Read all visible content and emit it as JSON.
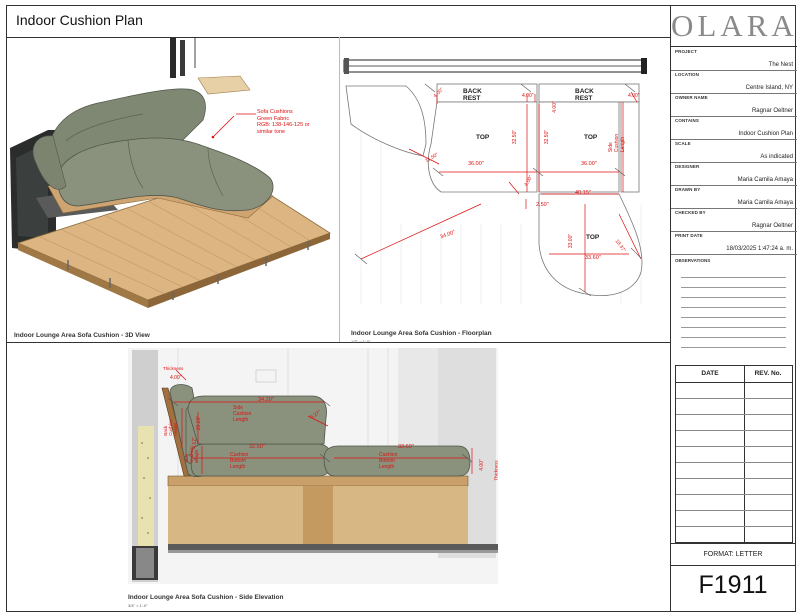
{
  "sheet": {
    "title": "Indoor Cushion Plan",
    "logo": "OLARA",
    "sheet_number": "F1911",
    "format": "FORMAT: LETTER"
  },
  "title_block": {
    "fields": [
      {
        "label": "PROJECT",
        "value": "The Nest"
      },
      {
        "label": "LOCATION",
        "value": "Centre Island, NY"
      },
      {
        "label": "OWNER NAME",
        "value": "Ragnar Oeltner"
      },
      {
        "label": "CONTAINS",
        "value": "Indoor Cushion Plan"
      },
      {
        "label": "SCALE",
        "value": "As indicated"
      },
      {
        "label": "DESIGNER",
        "value": "Maria Camila Amaya"
      },
      {
        "label": "DRAWN BY",
        "value": "Maria Camila Amaya"
      },
      {
        "label": "CHECKED BY",
        "value": "Ragnar Oeltner"
      },
      {
        "label": "PRINT DATE",
        "value": "18/03/2025 1:47:24 a. m."
      }
    ],
    "observations_label": "OBSERVATIONS",
    "rev_table": {
      "date_header": "DATE",
      "rev_header": "REV. No."
    }
  },
  "views": {
    "view_3d": {
      "label": "Indoor Lounge Area Sofa Cushion - 3D View"
    },
    "floorplan": {
      "label": "Indoor Lounge Area Sofa Cushion - Floorplan",
      "scale": "1/2\" = 1'-0\""
    },
    "elevation": {
      "label": "Indoor Lounge Area Sofa Cushion - Side Elevation",
      "scale": "3/4\" = 1'-0\""
    }
  },
  "annotations_3d": {
    "note_lines": [
      "Sofa Cushions",
      "Green Fabric",
      "RGB: 138-146-125 or",
      "similar tone"
    ]
  },
  "floorplan_annotations": {
    "back_rest_1": "BACK REST",
    "back_rest_2": "BACK REST",
    "top_1": "TOP",
    "top_2": "TOP",
    "top_3": "TOP",
    "d1": "4.00\"",
    "d2": "4.00\"",
    "d3": "4.00\"",
    "d4": "4.00\"",
    "d5": "4.00\"",
    "d6": "4.00\"",
    "side_len": "Side Cushion Length",
    "d_3250a": "32.50\"",
    "d_3250b": "32.50\"",
    "d_3300": "33.00\"",
    "d_3600a": "36.00\"",
    "d_3600b": "36.00\"",
    "d_4015": "40.15\"",
    "d_1150": "11.50\"",
    "d_250": "2.50\"",
    "d_3400": "34.00\"",
    "d_3360": "33.60\"",
    "d_1837": "18.37\""
  },
  "elevation_annotations": {
    "thickness": "Thickness",
    "t_400": "4.00\"",
    "d_3420": "34.20\"",
    "side_cushion_length": "Side Cushion Length",
    "back_cushion_height": "Back Cushion Height",
    "d_2020": "20.20\"",
    "d_1400": "14.00\"",
    "d_3270": "3.27\"",
    "d_412": "4.12\"",
    "side_cushion_height": "Side Cushion Height",
    "d_3250": "32.50\"",
    "cushion_bottom_length_1": "Cushion Bottom Length",
    "d_3360": "33.60\"",
    "cushion_bottom_length_2": "Cushion Bottom Length",
    "t_400b": "4.00\"",
    "thickness_2": "Thickness"
  },
  "colors": {
    "cushion": "#8a927d",
    "cushion_dark": "#6f7766",
    "annotation": "#dd1111",
    "deck_wood": "#d9b07e"
  }
}
